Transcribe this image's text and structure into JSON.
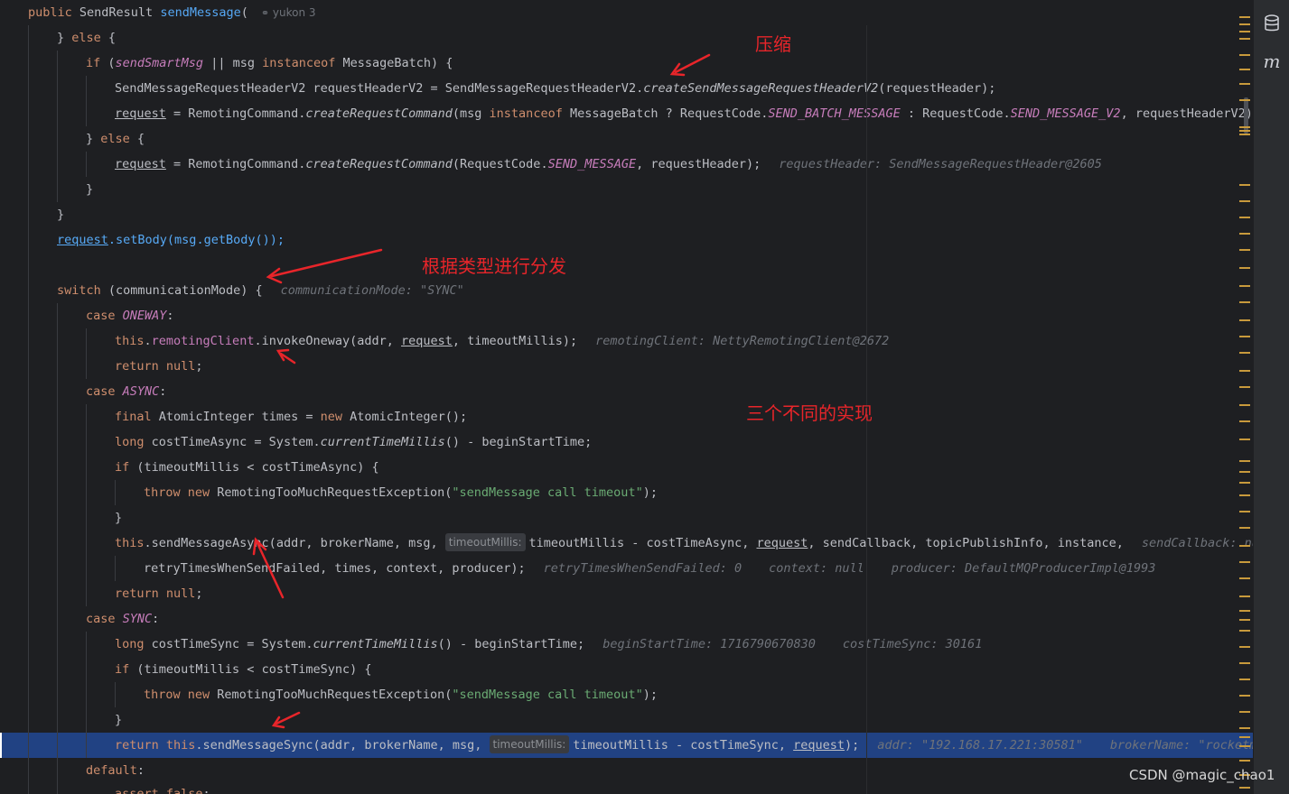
{
  "header": {
    "tokens": [
      "public ",
      "SendResult ",
      "sendMessage",
      "("
    ],
    "author": "yukon 3"
  },
  "code": {
    "l1": [
      "} ",
      "else",
      " {"
    ],
    "l2": [
      "if",
      " (",
      "sendSmartMsg",
      " || msg ",
      "instanceof",
      " MessageBatch) {"
    ],
    "l3": [
      "SendMessageRequestHeaderV2 requestHeaderV2 = SendMessageRequestHeaderV2.",
      "createSendMessageRequestHeaderV2",
      "(requestHeader);"
    ],
    "l4": [
      "request",
      " = RemotingCommand.",
      "createRequestCommand",
      "(msg ",
      "instanceof",
      " MessageBatch ? RequestCode.",
      "SEND_BATCH_MESSAGE",
      " : RequestCode.",
      "SEND_MESSAGE_V2",
      ", requestHeaderV2);"
    ],
    "l5": [
      "} ",
      "else",
      " {"
    ],
    "l6": [
      "request",
      " = RemotingCommand.",
      "createRequestCommand",
      "(RequestCode.",
      "SEND_MESSAGE",
      ", requestHeader);"
    ],
    "l6_hint": "requestHeader: SendMessageRequestHeader@2605",
    "l7": "}",
    "l8": "}",
    "l9": [
      "request",
      ".setBody(msg.getBody());"
    ],
    "l11": [
      "switch",
      " (communicationMode) {"
    ],
    "l11_hint": "communicationMode: \"SYNC\"",
    "l12": [
      "case ",
      "ONEWAY",
      ":"
    ],
    "l13": [
      "this",
      ".",
      "remotingClient",
      ".invokeOneway(addr, ",
      "request",
      ", timeoutMillis);"
    ],
    "l13_hint": "remotingClient: NettyRemotingClient@2672",
    "l14": [
      "return ",
      "null",
      ";"
    ],
    "l15": [
      "case ",
      "ASYNC",
      ":"
    ],
    "l16": [
      "final ",
      "AtomicInteger times = ",
      "new ",
      "AtomicInteger();"
    ],
    "l17": [
      "long ",
      "costTimeAsync = System.",
      "currentTimeMillis",
      "() - beginStartTime;"
    ],
    "l18": [
      "if",
      " (timeoutMillis < costTimeAsync) {"
    ],
    "l19": [
      "throw new ",
      "RemotingTooMuchRequestException(",
      "\"sendMessage call timeout\"",
      ");"
    ],
    "l20": "}",
    "l21": [
      "this",
      ".sendMessageAsync(addr, brokerName, msg, ",
      "timeoutMillis:",
      "timeoutMillis - costTimeAsync, ",
      "request",
      ", sendCallback, topicPublishInfo, instance,"
    ],
    "l21_hint": "sendCallback: null",
    "l22": "retryTimesWhenSendFailed, times, context, producer);",
    "l22_hints": [
      "retryTimesWhenSendFailed: 0",
      "context: null",
      "producer: DefaultMQProducerImpl@1993"
    ],
    "l23": [
      "return ",
      "null",
      ";"
    ],
    "l24": [
      "case ",
      "SYNC",
      ":"
    ],
    "l25": [
      "long ",
      "costTimeSync = System.",
      "currentTimeMillis",
      "() - beginStartTime;"
    ],
    "l25_hints": [
      "beginStartTime: 1716790670830",
      "costTimeSync: 30161"
    ],
    "l26": [
      "if",
      " (timeoutMillis < costTimeSync) {"
    ],
    "l27": [
      "throw new ",
      "RemotingTooMuchRequestException(",
      "\"sendMessage call timeout\"",
      ");"
    ],
    "l28": "}",
    "l29": [
      "return this",
      ".sendMessageSync(addr, brokerName, msg, ",
      "timeoutMillis:",
      "timeoutMillis - costTimeSync, ",
      "request",
      ");"
    ],
    "l29_hints": [
      "addr: \"192.168.17.221:30581\"",
      "brokerName: \"rocketm"
    ],
    "l30": [
      "default",
      ":"
    ],
    "l31": [
      "assert ",
      "false",
      ";"
    ]
  },
  "annotations": {
    "compress": "压缩",
    "dispatch": "根据类型进行分发",
    "three_impls": "三个不同的实现"
  },
  "right_bar": {
    "database_icon": "database-icon",
    "maven_label": "m"
  },
  "watermark": "CSDN @magic_chao1",
  "colors": {
    "background": "#1e1f22",
    "keyword": "#cf8e6d",
    "method": "#56a8f5",
    "static_field": "#c77dbb",
    "string": "#6aab73",
    "hint": "#6f737a",
    "execution_line": "#214283",
    "annotation_red": "#e8252a"
  }
}
